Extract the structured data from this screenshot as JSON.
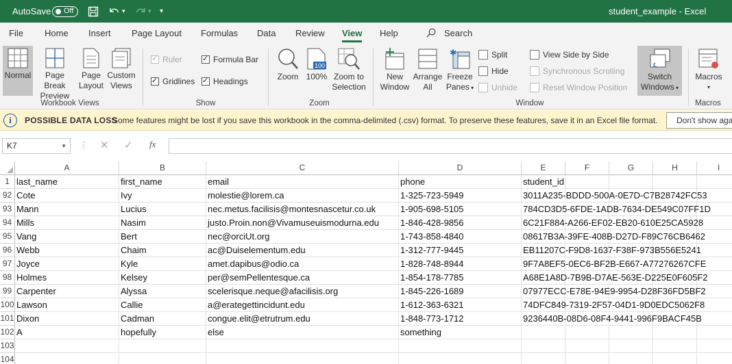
{
  "titlebar": {
    "autosave_label": "AutoSave",
    "autosave_state": "Off",
    "document_title": "student_example  -  Excel",
    "bg_color": "#217346"
  },
  "tabs": [
    "File",
    "Home",
    "Insert",
    "Page Layout",
    "Formulas",
    "Data",
    "Review",
    "View",
    "Help"
  ],
  "active_tab": "View",
  "search_label": "Search",
  "ribbon": {
    "workbook_views": {
      "label": "Workbook Views",
      "normal": "Normal",
      "page_break_1": "Page Break",
      "page_break_2": "Preview",
      "page_layout_1": "Page",
      "page_layout_2": "Layout",
      "custom_views_1": "Custom",
      "custom_views_2": "Views"
    },
    "show": {
      "label": "Show",
      "ruler": "Ruler",
      "formula_bar": "Formula Bar",
      "gridlines": "Gridlines",
      "headings": "Headings"
    },
    "zoom": {
      "label": "Zoom",
      "zoom": "Zoom",
      "hundred": "100%",
      "hundred_badge": "100",
      "zoom_sel_1": "Zoom to",
      "zoom_sel_2": "Selection"
    },
    "window": {
      "label": "Window",
      "new_window_1": "New",
      "new_window_2": "Window",
      "arrange_1": "Arrange",
      "arrange_2": "All",
      "freeze_1": "Freeze",
      "freeze_2": "Panes",
      "split": "Split",
      "hide": "Hide",
      "unhide": "Unhide",
      "side_by_side": "View Side by Side",
      "sync_scroll": "Synchronous Scrolling",
      "reset_pos": "Reset Window Position",
      "switch_1": "Switch",
      "switch_2": "Windows"
    },
    "macros": {
      "label": "Macros",
      "macros": "Macros"
    }
  },
  "message_bar": {
    "title": "POSSIBLE DATA LOSS",
    "text": "Some features might be lost if you save this workbook in the comma-delimited (.csv) format. To preserve these features, save it in an Excel file format.",
    "dismiss": "Don't show again"
  },
  "formula_bar": {
    "name_box": "K7",
    "fx": "fx",
    "value": ""
  },
  "grid": {
    "columns": [
      "A",
      "B",
      "C",
      "D",
      "E",
      "F",
      "G",
      "H",
      "I"
    ],
    "rows": [
      {
        "num": "1",
        "cells": [
          "last_name",
          "first_name",
          "email",
          "phone",
          "student_id"
        ]
      },
      {
        "num": "92",
        "cells": [
          "Cote",
          "Ivy",
          "molestie@lorem.ca",
          "1-325-723-5949",
          "3011A235-BDDD-500A-0E7D-C7B28742FC53"
        ]
      },
      {
        "num": "93",
        "cells": [
          "Mann",
          "Lucius",
          "nec.metus.facilisis@montesnascetur.co.uk",
          "1-905-698-5105",
          "784CD3D5-6FDE-1ADB-7634-DE549C07FF1D"
        ]
      },
      {
        "num": "94",
        "cells": [
          "Mills",
          "Nasim",
          "justo.Proin.non@Vivamuseuismodurna.edu",
          "1-846-428-9856",
          "6C21F884-A266-EF02-EB20-610E25CA5928"
        ]
      },
      {
        "num": "95",
        "cells": [
          "Vang",
          "Bert",
          "nec@orciUt.org",
          "1-743-858-4840",
          "08617B3A-39FE-408B-D27D-F89C76CB6462"
        ]
      },
      {
        "num": "96",
        "cells": [
          "Webb",
          "Chaim",
          "ac@Duiselementum.edu",
          "1-312-777-9445",
          "EB11207C-F9D8-1637-F38F-973B556E5241"
        ]
      },
      {
        "num": "97",
        "cells": [
          "Joyce",
          "Kyle",
          "amet.dapibus@odio.ca",
          "1-828-748-8944",
          "9F7A8EF5-0EC6-BF2B-E667-A77276267CFE"
        ]
      },
      {
        "num": "98",
        "cells": [
          "Holmes",
          "Kelsey",
          "per@semPellentesque.ca",
          "1-854-178-7785",
          "A68E1A8D-7B9B-D7AE-563E-D225E0F605F2"
        ]
      },
      {
        "num": "99",
        "cells": [
          "Carpenter",
          "Alyssa",
          "scelerisque.neque@afacilisis.org",
          "1-845-226-1689",
          "07977ECC-E78E-94E9-9954-D28F36FD5BF2"
        ]
      },
      {
        "num": "100",
        "cells": [
          "Lawson",
          "Callie",
          "a@erategettincidunt.edu",
          "1-612-363-6321",
          "74DFC849-7319-2F57-04D1-9D0EDC5062F8"
        ]
      },
      {
        "num": "101",
        "cells": [
          "Dixon",
          "Cadman",
          "congue.elit@etrutrum.edu",
          "1-848-773-1712",
          "9236440B-08D6-08F4-9441-996F9BACF45B"
        ]
      },
      {
        "num": "102",
        "cells": [
          "A",
          "hopefully",
          "else",
          "something",
          ""
        ]
      },
      {
        "num": "103",
        "cells": [
          "",
          "",
          "",
          "",
          ""
        ]
      },
      {
        "num": "104",
        "cells": [
          "",
          "",
          "",
          "",
          ""
        ]
      }
    ]
  }
}
